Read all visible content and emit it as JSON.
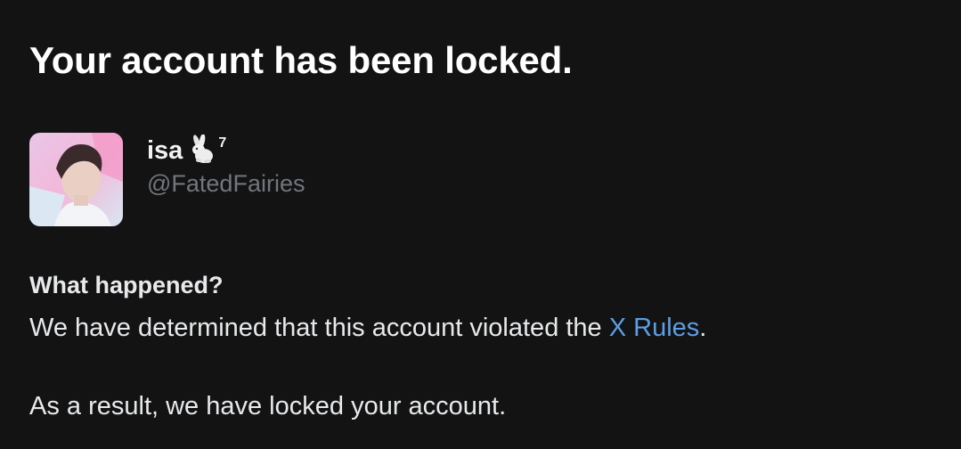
{
  "title": "Your account has been locked.",
  "profile": {
    "display_name": "isa",
    "emoji_icon": "rabbit-icon",
    "superscript": "7",
    "handle": "@FatedFairies"
  },
  "section": {
    "heading": "What happened?",
    "paragraph1_prefix": "We have determined that this account violated the ",
    "rules_link": "X Rules",
    "paragraph1_suffix": ".",
    "paragraph2": "As a result, we have locked your account."
  },
  "colors": {
    "background": "#131314",
    "text": "#e7e9ea",
    "muted": "#71767b",
    "link": "#5c9ee6"
  }
}
